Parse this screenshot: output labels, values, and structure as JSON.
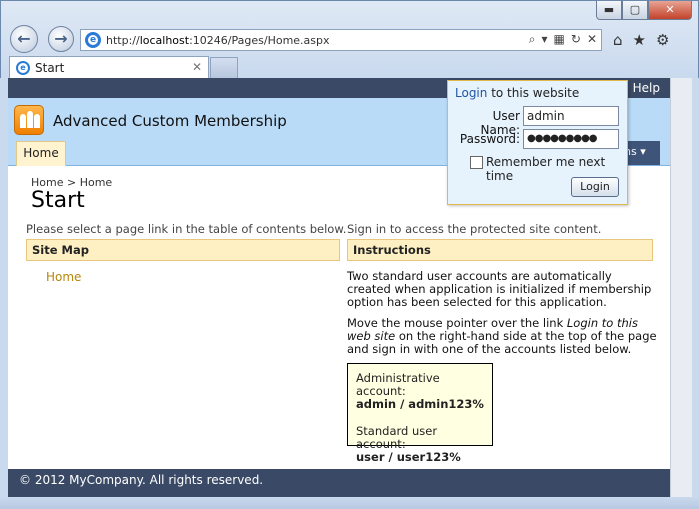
{
  "browser": {
    "url_prefix": "http://",
    "url_host": "localhost",
    "url_path": ":10246/Pages/Home.aspx",
    "tab_title": "Start",
    "win_min": "▬",
    "win_max": "▢",
    "win_close": "✕",
    "back": "←",
    "forward": "→",
    "icon_search": "⌕",
    "icon_dropdown": "▾",
    "icon_compat": "▦",
    "icon_refresh": "↻",
    "icon_stop": "✕",
    "icon_home": "⌂",
    "icon_favorites": "★",
    "icon_tools": "⚙",
    "tab_close": "✕"
  },
  "site": {
    "help": "Help",
    "separator": "|",
    "app_title": "Advanced Custom Membership",
    "menu_home": "Home",
    "menu_right": "ns ▾"
  },
  "page": {
    "breadcrumb": "Home  >  Home",
    "title": "Start",
    "left_note": "Please select a page link in the table of contents below.",
    "right_note": "Sign in to access the protected site content.",
    "sitemap_head": "Site Map",
    "sitemap_link": "Home",
    "instructions_head": "Instructions",
    "para1": "Two standard user accounts are automatically created when application is initialized if membership option has been selected for this application.",
    "para2_a": "Move the mouse pointer over the link ",
    "para2_link": "Login to this web site",
    "para2_b": " on the right-hand side at the top of the page and sign in with one of the accounts listed below.",
    "admin_label": "Administrative account:",
    "admin_creds": "admin / admin123%",
    "user_label": "Standard user account:",
    "user_creds": "user / user123%",
    "footer": "© 2012 MyCompany. All rights reserved."
  },
  "login": {
    "title_link": "Login",
    "title_rest": " to this website",
    "username_label": "User Name:",
    "username_value": "admin",
    "password_label": "Password:",
    "password_value": "●●●●●●●●●",
    "remember_label": "Remember me next time",
    "button": "Login"
  }
}
